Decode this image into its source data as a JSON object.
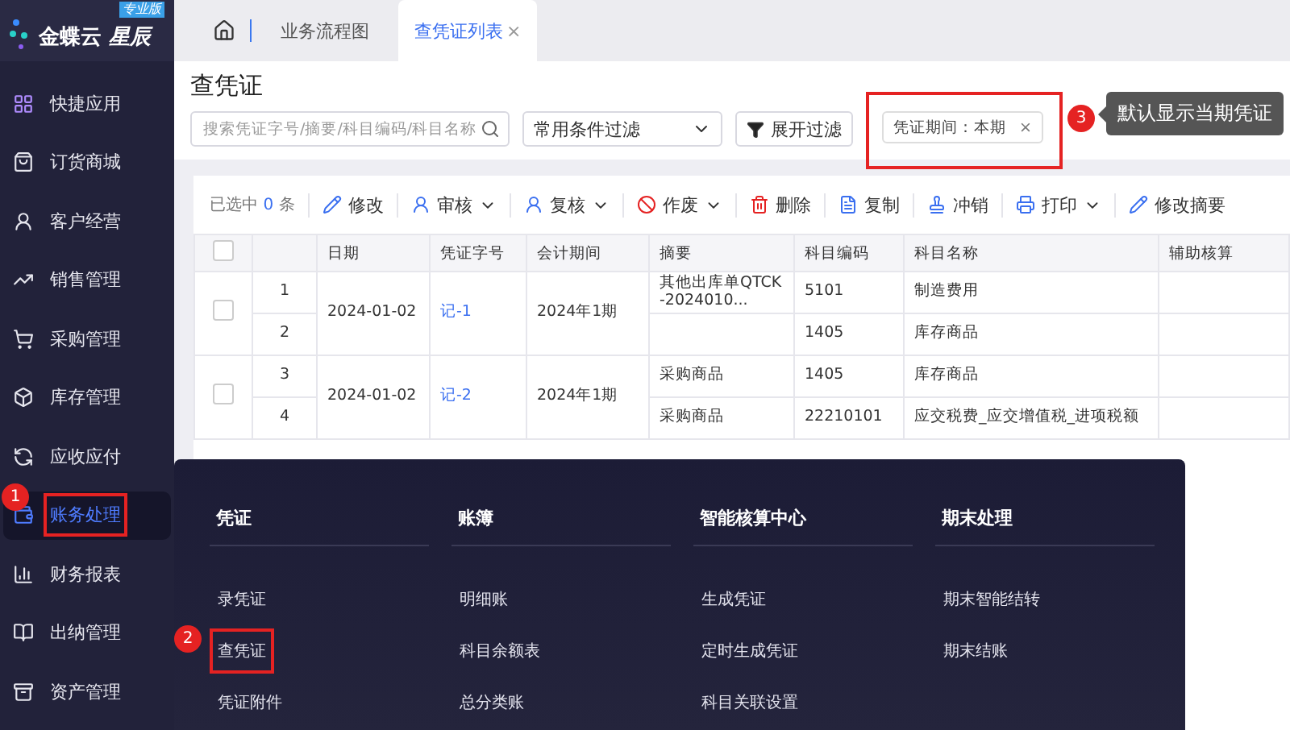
{
  "brand": {
    "name": "金蝶云",
    "product": "星辰",
    "edition": "专业版"
  },
  "sidebar": {
    "items": [
      {
        "label": "快捷应用",
        "selected": false
      },
      {
        "label": "订货商城",
        "selected": false
      },
      {
        "label": "客户经营",
        "selected": false
      },
      {
        "label": "销售管理",
        "selected": false
      },
      {
        "label": "采购管理",
        "selected": false
      },
      {
        "label": "库存管理",
        "selected": false
      },
      {
        "label": "应收应付",
        "selected": false
      },
      {
        "label": "账务处理",
        "selected": true,
        "callout": "1"
      },
      {
        "label": "财务报表",
        "selected": false
      },
      {
        "label": "出纳管理",
        "selected": false
      },
      {
        "label": "资产管理",
        "selected": false
      }
    ]
  },
  "tabs": [
    {
      "label": "业务流程图",
      "selected": false
    },
    {
      "label": "查凭证列表",
      "selected": true,
      "close": "×"
    }
  ],
  "page_title": "查凭证",
  "filters": {
    "search": {
      "placeholder": "搜索凭证字号/摘要/科目编码/科目名称"
    },
    "preset": "常用条件过滤",
    "expand": "展开过滤",
    "tag": {
      "label": "凭证期间：本期",
      "close": "×",
      "callout": "3",
      "note": "默认显示当期凭证"
    }
  },
  "toolbar": {
    "selection": {
      "prefix": "已选中",
      "count": "0",
      "suffix": "条"
    },
    "buttons": [
      {
        "label": "修改",
        "dropdown": false
      },
      {
        "label": "审核",
        "dropdown": true
      },
      {
        "label": "复核",
        "dropdown": true
      },
      {
        "label": "作废",
        "dropdown": true
      },
      {
        "label": "删除",
        "dropdown": false
      },
      {
        "label": "复制",
        "dropdown": false
      },
      {
        "label": "冲销",
        "dropdown": false
      },
      {
        "label": "打印",
        "dropdown": true
      },
      {
        "label": "修改摘要",
        "dropdown": false
      }
    ]
  },
  "table": {
    "header_checked": false,
    "columns": [
      "日期",
      "凭证字号",
      "会计期间",
      "摘要",
      "科目编码",
      "科目名称",
      "辅助核算"
    ],
    "vouchers": [
      {
        "checked": false,
        "date": "2024-01-02",
        "number": "记-1",
        "period": "2024年1期",
        "lines": [
          {
            "index": "1",
            "summary": "其他出库单QTCK-2024010...",
            "code": "5101",
            "name": "制造费用"
          },
          {
            "index": "2",
            "code": "1405",
            "name": "库存商品"
          }
        ]
      },
      {
        "checked": false,
        "date": "2024-01-02",
        "number": "记-2",
        "period": "2024年1期",
        "lines": [
          {
            "index": "3",
            "summary": "采购商品",
            "code": "1405",
            "name": "库存商品"
          },
          {
            "index": "4",
            "summary": "采购商品",
            "code": "22210101",
            "name": "应交税费_应交增值税_进项税额"
          }
        ]
      }
    ]
  },
  "menu": {
    "columns": [
      {
        "heading": "凭证",
        "items": [
          {
            "label": "录凭证"
          },
          {
            "label": "查凭证",
            "callout": "2"
          },
          {
            "label": "凭证附件"
          }
        ]
      },
      {
        "heading": "账簿",
        "items": [
          {
            "label": "明细账"
          },
          {
            "label": "科目余额表"
          },
          {
            "label": "总分类账"
          }
        ]
      },
      {
        "heading": "智能核算中心",
        "items": [
          {
            "label": "生成凭证"
          },
          {
            "label": "定时生成凭证"
          },
          {
            "label": "科目关联设置"
          }
        ]
      },
      {
        "heading": "期末处理",
        "items": [
          {
            "label": "期末智能结转"
          },
          {
            "label": "期末结账"
          }
        ]
      }
    ]
  }
}
